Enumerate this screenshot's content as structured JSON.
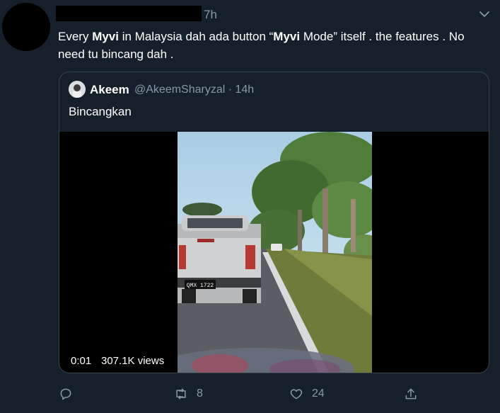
{
  "tweet": {
    "time": "7h",
    "text_parts": {
      "p1": "Every ",
      "b1": "Myvi",
      "p2": " in Malaysia dah ada button “",
      "b2": "Myvi",
      "p3": " Mode” itself . the features . No need tu bincang dah ."
    }
  },
  "quote": {
    "name": "Akeem",
    "handle_time": "@AkeemSharyzal · 14h",
    "text": "Bincangkan",
    "video": {
      "duration": "0:01",
      "views": "307.1K views",
      "plate": "QMX 1722"
    }
  },
  "actions": {
    "retweets": "8",
    "likes": "24"
  },
  "icons": [
    "chevron-down-icon",
    "reply-icon",
    "retweet-icon",
    "like-icon",
    "share-icon"
  ],
  "colors": {
    "background": "#15202b",
    "secondary_text": "#8899a6",
    "border": "#38444d"
  }
}
